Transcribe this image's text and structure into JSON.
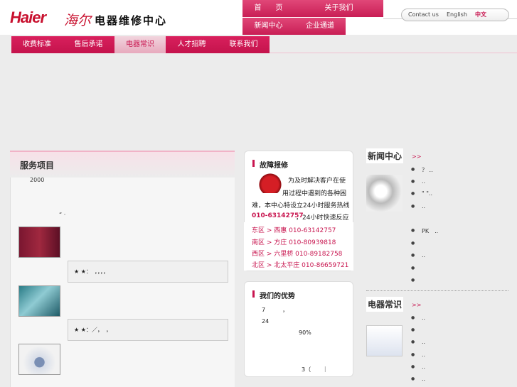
{
  "header": {
    "logo_text": "Haier",
    "logo_cn": "海尔",
    "site_title": "电器维修中心"
  },
  "topnav": {
    "items": [
      {
        "label": "首　　页"
      },
      {
        "label": "关于我们"
      },
      {
        "label": "新闻中心"
      },
      {
        "label": "企业通道"
      }
    ]
  },
  "lang": {
    "items": [
      "Contact us",
      "English",
      "中文"
    ]
  },
  "mainnav": {
    "items": [
      {
        "label": "收费标准"
      },
      {
        "label": "售后承诺"
      },
      {
        "label": "电器常识"
      },
      {
        "label": "人才招聘"
      },
      {
        "label": "联系我们"
      }
    ]
  },
  "services": {
    "title": "服务项目",
    "intro": "2000",
    "dots": "“ ·",
    "boxes": [
      "★ ★：　，，，，",
      "★ ★：／，　，"
    ]
  },
  "repair": {
    "title": "故障报修",
    "text_lines": [
      "为及时解决客户在使",
      "用过程中遇到的各种困",
      "难，本中心特设立24小时服务热线"
    ],
    "hotline": "010-63142757",
    "hotline_suffix": "，24小时快速反应",
    "districts": [
      {
        "area": "东区",
        "place": "西惠",
        "phone": "010-63142757"
      },
      {
        "area": "南区",
        "place": "方庄",
        "phone": "010-80939818"
      },
      {
        "area": "西区",
        "place": "六里桥",
        "phone": "010-89182758"
      },
      {
        "area": "北区",
        "place": "北太平庄",
        "phone": "010-86659721"
      }
    ]
  },
  "advantages": {
    "title": "我们的优势",
    "lines": [
      "7　　　，",
      "24",
      "90%",
      "3（　　｜"
    ]
  },
  "news": {
    "title": "新闻中心",
    "more": ">>",
    "items": [
      "？ ..",
      "..",
      "\" \"..",
      "..",
      "PK　..",
      "",
      "",
      " ..",
      "",
      ""
    ]
  },
  "tips": {
    "title": "电器常识",
    "more": ">>",
    "items": [
      "..",
      "",
      "..",
      "..",
      "..",
      ".."
    ]
  }
}
